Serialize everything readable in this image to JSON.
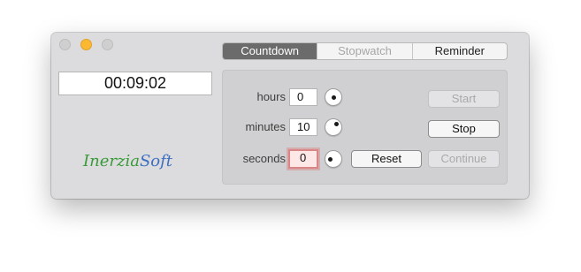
{
  "window": {
    "controls": {
      "close": "close-icon",
      "minimize": "minimize-icon",
      "zoom": "zoom-icon"
    }
  },
  "display": {
    "time": "00:09:02"
  },
  "logo": {
    "part1": "Inerzia",
    "part2": "Soft",
    "colors": {
      "part1": "#3a9a3a",
      "part2": "#3d6ec0"
    }
  },
  "tabs": [
    {
      "label": "Countdown",
      "state": "selected"
    },
    {
      "label": "Stopwatch",
      "state": "disabled"
    },
    {
      "label": "Reminder",
      "state": "normal"
    }
  ],
  "fields": {
    "hours": {
      "label": "hours",
      "value": "0"
    },
    "minutes": {
      "label": "minutes",
      "value": "10"
    },
    "seconds": {
      "label": "seconds",
      "value": "0"
    }
  },
  "buttons": {
    "start": {
      "label": "Start",
      "enabled": false
    },
    "stop": {
      "label": "Stop",
      "enabled": true
    },
    "reset": {
      "label": "Reset",
      "enabled": true
    },
    "continue": {
      "label": "Continue",
      "enabled": false
    }
  },
  "colors": {
    "accent": "#fbb832",
    "selected_tab": "#6b6b6b",
    "focus_ring": "#d98686"
  }
}
